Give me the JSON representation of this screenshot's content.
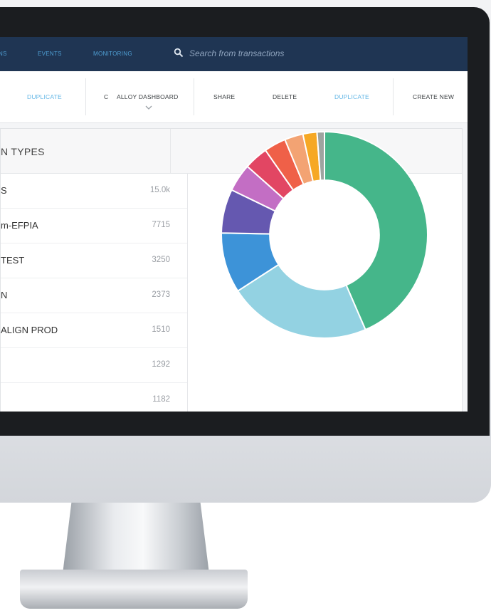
{
  "nav": {
    "items": [
      "NS",
      "EVENTS",
      "MONITORING"
    ],
    "search_placeholder": "Search from transactions"
  },
  "toolbar": {
    "left_duplicate": "DUPLICATE",
    "dashboard_prefix": "C",
    "dashboard_label": "ALLOY DASHBOARD",
    "share": "SHARE",
    "delete": "DELETE",
    "duplicate": "DUPLICATE",
    "create_new": "CREATE NEW"
  },
  "panel": {
    "title": "N TYPES",
    "rows": [
      {
        "label": "S",
        "value": "15.0k"
      },
      {
        "label": "m-EFPIA",
        "value": "7715"
      },
      {
        "label": "TEST",
        "value": "3250"
      },
      {
        "label": "N",
        "value": "2373"
      },
      {
        "label": "ALIGN PROD",
        "value": "1510"
      },
      {
        "label": "",
        "value": "1292"
      },
      {
        "label": "",
        "value": "1182"
      }
    ]
  },
  "chart_data": {
    "type": "pie",
    "slices": [
      {
        "value": 15000,
        "color": "#45b68a"
      },
      {
        "value": 7715,
        "color": "#93d2e2"
      },
      {
        "value": 3250,
        "color": "#3d93d8"
      },
      {
        "value": 2373,
        "color": "#6558b0"
      },
      {
        "value": 1510,
        "color": "#c36ec4"
      },
      {
        "value": 1292,
        "color": "#e24663"
      },
      {
        "value": 1182,
        "color": "#ef6048"
      },
      {
        "value": 1000,
        "color": "#f3a373"
      },
      {
        "value": 760,
        "color": "#f6a824"
      },
      {
        "value": 400,
        "color": "#9ea4a0"
      }
    ],
    "inner_radius_ratio": 0.53
  }
}
